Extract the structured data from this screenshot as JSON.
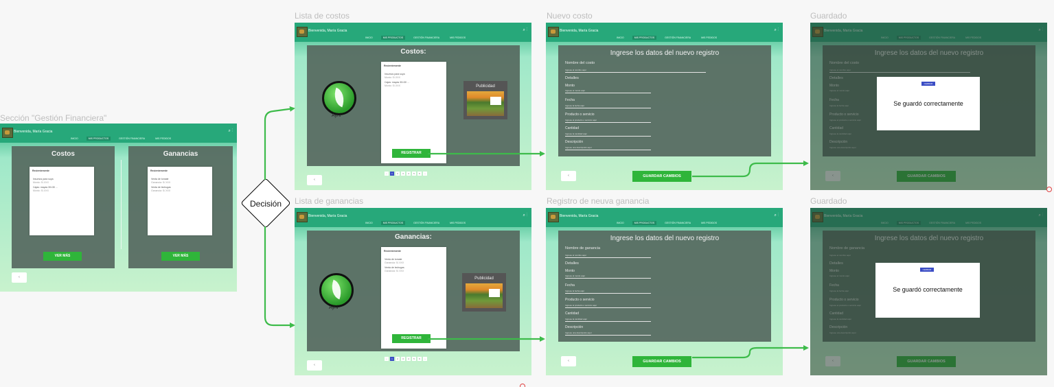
{
  "titles": {
    "seccion": "Sección \"Gestión Financiera\"",
    "lista_costos": "Lista de costos",
    "nuevo_costo": "Nuevo costo",
    "guardado_1": "Guardado",
    "lista_ganancias": "Lista de ganancias",
    "registro_ganancia": "Registro de neuva ganancia",
    "guardado_2": "Guardado"
  },
  "decision": "Decisión",
  "header": {
    "welcome": "Bienvenida, María Gracia",
    "nav": [
      "INICIO",
      "MIS PRODUCTOS",
      "GESTIÓN FINANCIERA",
      "MIS PEDIDOS"
    ],
    "icons": [
      "search-icon",
      "more-vert-icon"
    ]
  },
  "seccion": {
    "costos": "Costos",
    "ganancias": "Ganancias",
    "ver_mas": "VER MÁS",
    "back": "‹",
    "costos_card": {
      "title": "Recientemente",
      "items": [
        {
          "name": "Insumos para soya",
          "sub": "Monto: S/.XXX"
        },
        {
          "name": "Cajas: mayas 30×30 …",
          "sub": "Monto: S/.XXX"
        }
      ]
    },
    "ganancias_card": {
      "title": "Recientemente",
      "items": [
        {
          "name": "Venta de tomate",
          "sub": "Ganancia: S/.XXX"
        },
        {
          "name": "Venta de lechugas",
          "sub": "Ganancia: S/.XXX"
        }
      ]
    }
  },
  "lista": {
    "costos_title": "Costos:",
    "ganancias_title": "Ganancias:",
    "logo_text": "Ayni",
    "ad_title": "Publicidad",
    "registrar": "REGISTRAR",
    "back": "‹",
    "pages": [
      "‹",
      "1",
      "2",
      "3",
      "4",
      "5",
      "6",
      "›"
    ],
    "costos_card": {
      "title": "Recientemente",
      "items": [
        {
          "name": "Insumos para soya",
          "sub": "Monto: S/.XXX"
        },
        {
          "name": "Cajas: mayas 30×30 …",
          "sub": "Monto: S/.XXX"
        }
      ]
    },
    "ganancias_card": {
      "title": "Recientemente",
      "items": [
        {
          "name": "Venta de tomate",
          "sub": "Ganancia: S/.XXX"
        },
        {
          "name": "Venta de lechugas",
          "sub": "Ganancia: S/.XXX"
        }
      ]
    }
  },
  "form": {
    "heading": "Ingrese los datos del nuevo registro",
    "nombre_costo": "Nombre del costo",
    "nombre_ganancia": "Nombre de ganancia",
    "hint_nombre": "Ingrese el nombre aquí",
    "detalles": "Detalles",
    "monto": "Monto",
    "hint_monto": "Ingrese el monto aquí",
    "fecha": "Fecha",
    "hint_fecha": "Ingrese la fecha aquí",
    "producto": "Producto o servicio",
    "hint_producto": "Ingrese el producto o servicio aquí",
    "cantidad": "Cantidad",
    "hint_cantidad": "Ingrese la cantidad aquí",
    "descripcion": "Descripción",
    "hint_descripcion": "Ingrese una descripción aquí",
    "guardar": "GUARDAR CAMBIOS",
    "back": "‹"
  },
  "modal": {
    "cerrar": "CERRAR",
    "message": "Se guardó correctamente"
  },
  "colors": {
    "header": "#27a87a",
    "panel": "#566960",
    "button": "#2fb53a",
    "arrow": "#3dbb4a",
    "page_active": "#3b4dc5"
  }
}
